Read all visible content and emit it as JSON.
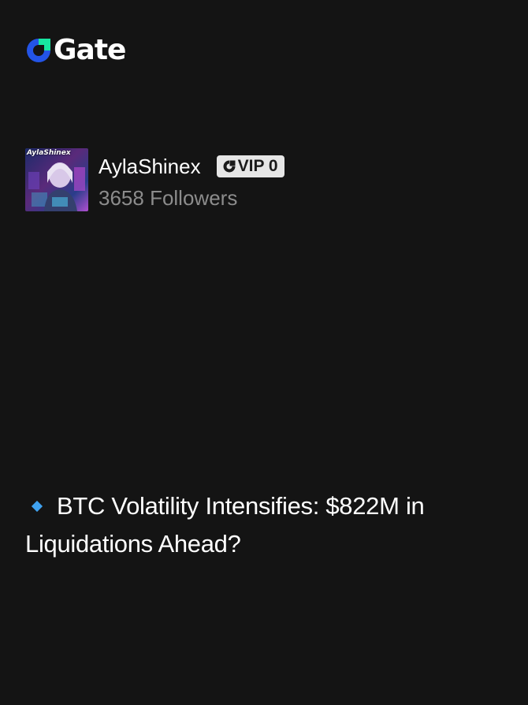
{
  "brand": {
    "name": "Gate",
    "logo_icon": "gate-logo-icon",
    "colors": {
      "blue": "#2354e6",
      "green": "#17e6a1"
    }
  },
  "profile": {
    "avatar_icon": "avatar-image",
    "avatar_tag": "AylaShinex",
    "username": "AylaShinex",
    "vip_label": "VIP 0",
    "followers": "3658 Followers"
  },
  "post": {
    "bullet_icon": "blue-diamond-icon",
    "headline": "BTC Volatility Intensifies: $822M in Liquidations Ahead?"
  }
}
